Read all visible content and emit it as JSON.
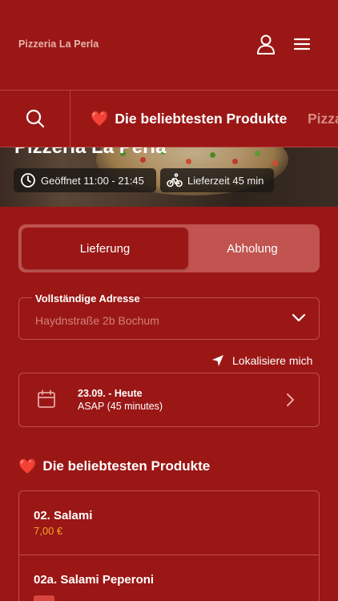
{
  "header": {
    "brand": "Pizzeria La Perla"
  },
  "category_bar": {
    "tabs": [
      {
        "label": "Die beliebtesten Produkte",
        "emoji": "❤️",
        "active": true
      },
      {
        "label": "Pizza",
        "active": false
      }
    ]
  },
  "hero": {
    "title": "Pizzeria La Perla",
    "opening_hours": "Geöffnet 11:00 - 21:45",
    "delivery_time": "Lieferzeit 45 min"
  },
  "order_mode": {
    "delivery_label": "Lieferung",
    "pickup_label": "Abholung",
    "selected": "Lieferung"
  },
  "address": {
    "label": "Vollständige Adresse",
    "value": "Haydnstraße 2b Bochum"
  },
  "locate": {
    "label": "Lokalisiere mich"
  },
  "schedule": {
    "date": "23.09. - Heute",
    "time": "ASAP (45 minutes)"
  },
  "popular": {
    "title": "Die beliebtesten Produkte",
    "emoji": "❤️",
    "products": [
      {
        "name": "02. Salami",
        "price": "7,00 €"
      },
      {
        "name": "02a. Salami Peperoni"
      }
    ]
  },
  "colors": {
    "background": "#9a1715",
    "border": "#c0504c",
    "toggle_track": "#c15450",
    "price": "#f5a623",
    "heart": "#e0242d"
  },
  "icons": [
    "user-icon",
    "menu-icon",
    "search-icon",
    "heart-icon",
    "clock-icon",
    "bicycle-icon",
    "chevron-down-icon",
    "location-arrow-icon",
    "calendar-icon",
    "chevron-right-icon"
  ]
}
